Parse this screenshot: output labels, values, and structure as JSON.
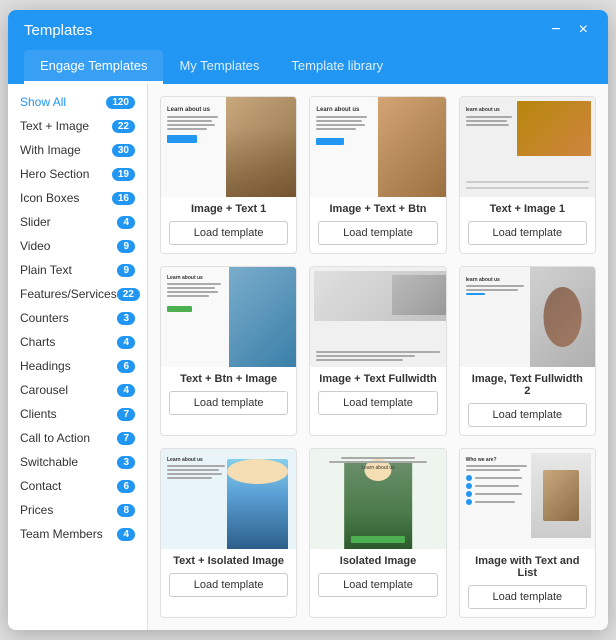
{
  "modal": {
    "title": "Templates",
    "minimize_label": "−",
    "close_label": "×"
  },
  "tabs": [
    {
      "id": "engage",
      "label": "Engage Templates",
      "active": true
    },
    {
      "id": "my",
      "label": "My Templates",
      "active": false
    },
    {
      "id": "library",
      "label": "Template library",
      "active": false
    }
  ],
  "sidebar": {
    "items": [
      {
        "label": "Show All",
        "count": "120",
        "active": true
      },
      {
        "label": "Text + Image",
        "count": "22",
        "active": false
      },
      {
        "label": "With Image",
        "count": "30",
        "active": false
      },
      {
        "label": "Hero Section",
        "count": "19",
        "active": false
      },
      {
        "label": "Icon Boxes",
        "count": "16",
        "active": false
      },
      {
        "label": "Slider",
        "count": "4",
        "active": false
      },
      {
        "label": "Video",
        "count": "9",
        "active": false
      },
      {
        "label": "Plain Text",
        "count": "9",
        "active": false
      },
      {
        "label": "Features/Services",
        "count": "22",
        "active": false
      },
      {
        "label": "Counters",
        "count": "3",
        "active": false
      },
      {
        "label": "Charts",
        "count": "4",
        "active": false
      },
      {
        "label": "Headings",
        "count": "6",
        "active": false
      },
      {
        "label": "Carousel",
        "count": "4",
        "active": false
      },
      {
        "label": "Clients",
        "count": "7",
        "active": false
      },
      {
        "label": "Call to Action",
        "count": "7",
        "active": false
      },
      {
        "label": "Switchable",
        "count": "3",
        "active": false
      },
      {
        "label": "Contact",
        "count": "6",
        "active": false
      },
      {
        "label": "Prices",
        "count": "8",
        "active": false
      },
      {
        "label": "Team Members",
        "count": "4",
        "active": false
      }
    ]
  },
  "templates": [
    {
      "id": 1,
      "name": "Image + Text 1",
      "load_label": "Load template",
      "thumb_type": "img-text"
    },
    {
      "id": 2,
      "name": "Image + Text + Btn",
      "load_label": "Load template",
      "thumb_type": "img-text-btn"
    },
    {
      "id": 3,
      "name": "Text + Image 1",
      "load_label": "Load template",
      "thumb_type": "text-img"
    },
    {
      "id": 4,
      "name": "Text + Btn + Image",
      "load_label": "Load template",
      "thumb_type": "text-btn-img"
    },
    {
      "id": 5,
      "name": "Image + Text Fullwidth",
      "load_label": "Load template",
      "thumb_type": "img-text-full"
    },
    {
      "id": 6,
      "name": "Image, Text Fullwidth 2",
      "load_label": "Load template",
      "thumb_type": "img-text-full2"
    },
    {
      "id": 7,
      "name": "Text + Isolated Image",
      "load_label": "Load template",
      "thumb_type": "text-isolated"
    },
    {
      "id": 8,
      "name": "Isolated Image",
      "load_label": "Load template",
      "thumb_type": "isolated"
    },
    {
      "id": 9,
      "name": "Image with Text and List",
      "load_label": "Load template",
      "thumb_type": "img-text-list"
    }
  ]
}
